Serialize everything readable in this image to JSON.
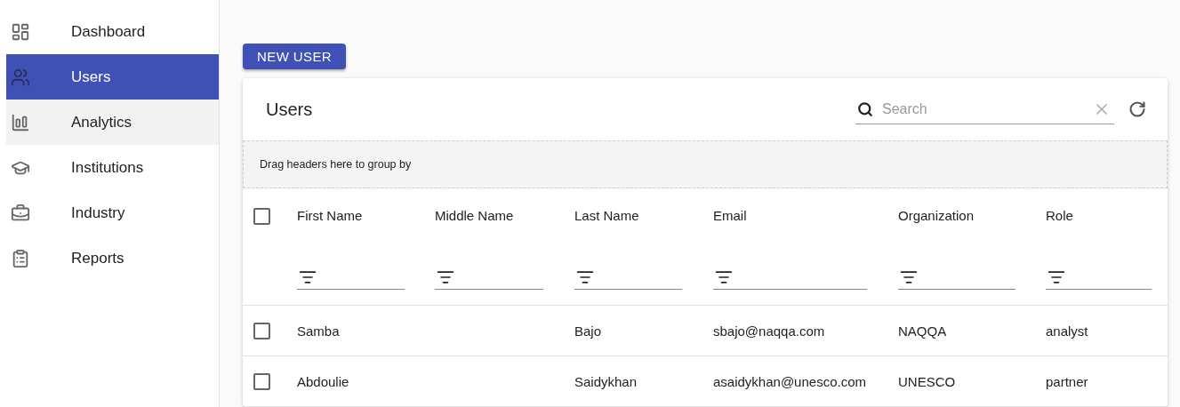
{
  "sidebar": {
    "items": [
      {
        "kind": "dashboard",
        "label": "Dashboard",
        "selected": false,
        "highlighted": false
      },
      {
        "kind": "users",
        "label": "Users",
        "selected": true,
        "highlighted": false
      },
      {
        "kind": "analytics",
        "label": "Analytics",
        "selected": false,
        "highlighted": true
      },
      {
        "kind": "institutions",
        "label": "Institutions",
        "selected": false,
        "highlighted": false
      },
      {
        "kind": "industry",
        "label": "Industry",
        "selected": false,
        "highlighted": false
      },
      {
        "kind": "reports",
        "label": "Reports",
        "selected": false,
        "highlighted": false
      }
    ]
  },
  "new_user_button": "NEW USER",
  "table": {
    "title": "Users",
    "search": {
      "placeholder": "Search"
    },
    "group_hint": "Drag headers here to group by",
    "select_all": {
      "checked": false
    },
    "columns": [
      "First Name",
      "Middle Name",
      "Last Name",
      "Email",
      "Organization",
      "Role"
    ],
    "rows": [
      {
        "checked": false,
        "cells": [
          "Samba",
          null,
          "Bajo",
          "sbajo@naqqa.com",
          "NAQQA",
          "analyst"
        ]
      },
      {
        "checked": false,
        "cells": [
          "Abdoulie",
          null,
          "Saidykhan",
          "asaidykhan@unesco.com",
          "UNESCO",
          "partner"
        ]
      }
    ]
  }
}
